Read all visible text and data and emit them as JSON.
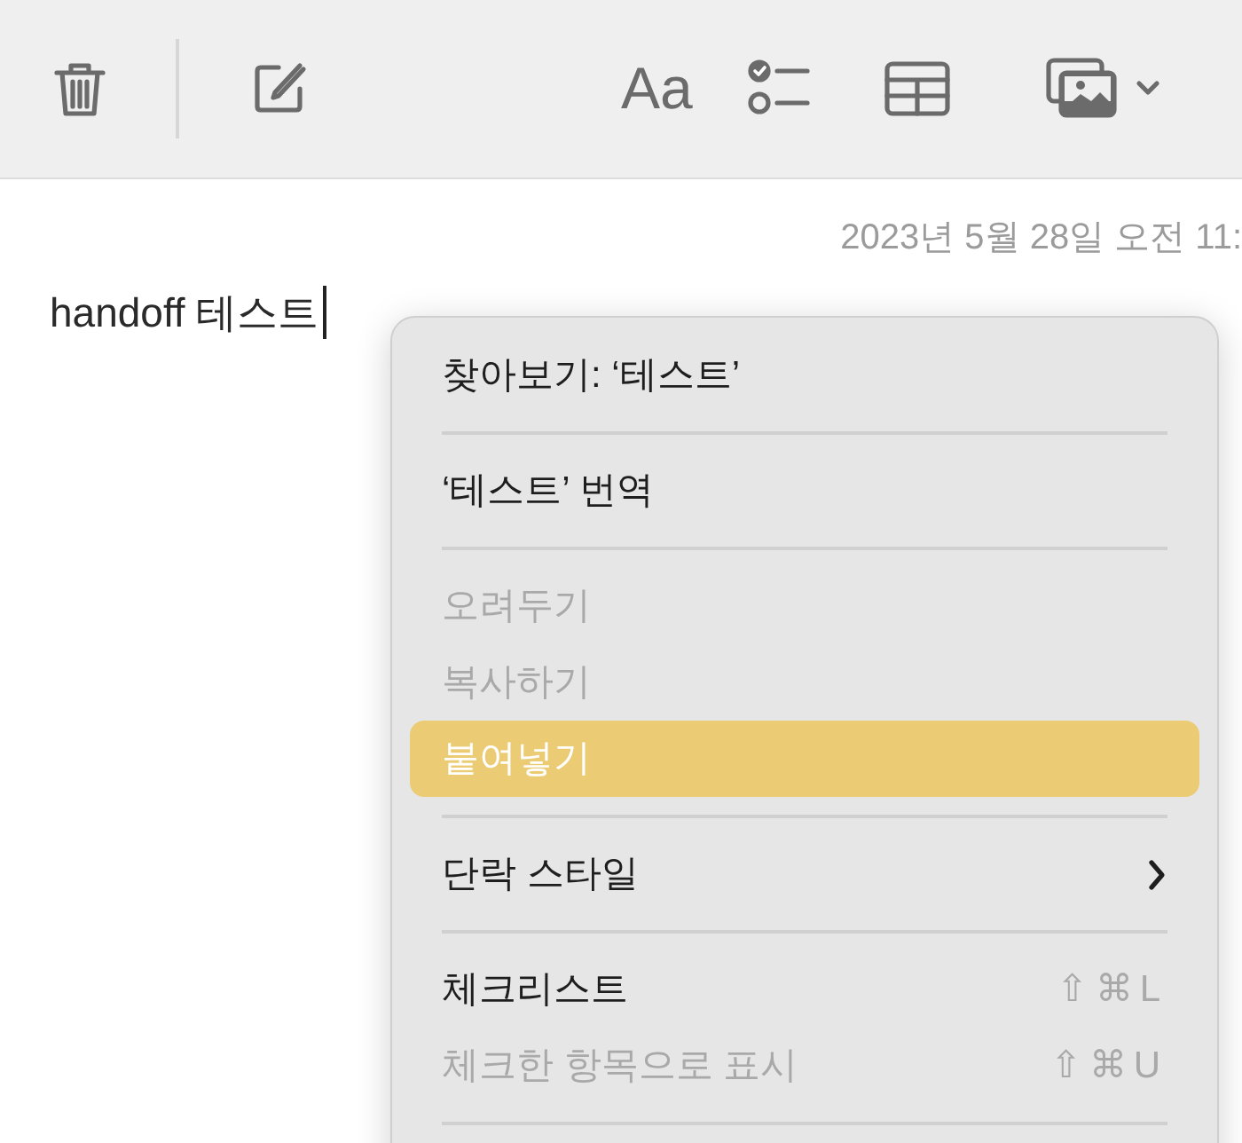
{
  "toolbar": {
    "format_label": "Aa"
  },
  "note": {
    "date": "2023년 5월 28일 오전 11:",
    "text": "handoff 테스트"
  },
  "context_menu": [
    {
      "kind": "item",
      "label": "찾아보기: ‘테스트’",
      "disabled": false,
      "selected": false
    },
    {
      "kind": "separator"
    },
    {
      "kind": "item",
      "label": "‘테스트’ 번역",
      "disabled": false,
      "selected": false
    },
    {
      "kind": "separator"
    },
    {
      "kind": "item",
      "label": "오려두기",
      "disabled": true,
      "selected": false
    },
    {
      "kind": "item",
      "label": "복사하기",
      "disabled": true,
      "selected": false
    },
    {
      "kind": "item",
      "label": "붙여넣기",
      "disabled": false,
      "selected": true
    },
    {
      "kind": "separator"
    },
    {
      "kind": "submenu",
      "label": "단락 스타일",
      "disabled": false,
      "selected": false
    },
    {
      "kind": "separator"
    },
    {
      "kind": "item",
      "label": "체크리스트",
      "disabled": false,
      "selected": false,
      "shortcut": "⇧⌘L"
    },
    {
      "kind": "item",
      "label": "체크한 항목으로 표시",
      "disabled": true,
      "selected": false,
      "shortcut": "⇧⌘U"
    },
    {
      "kind": "separator"
    }
  ]
}
